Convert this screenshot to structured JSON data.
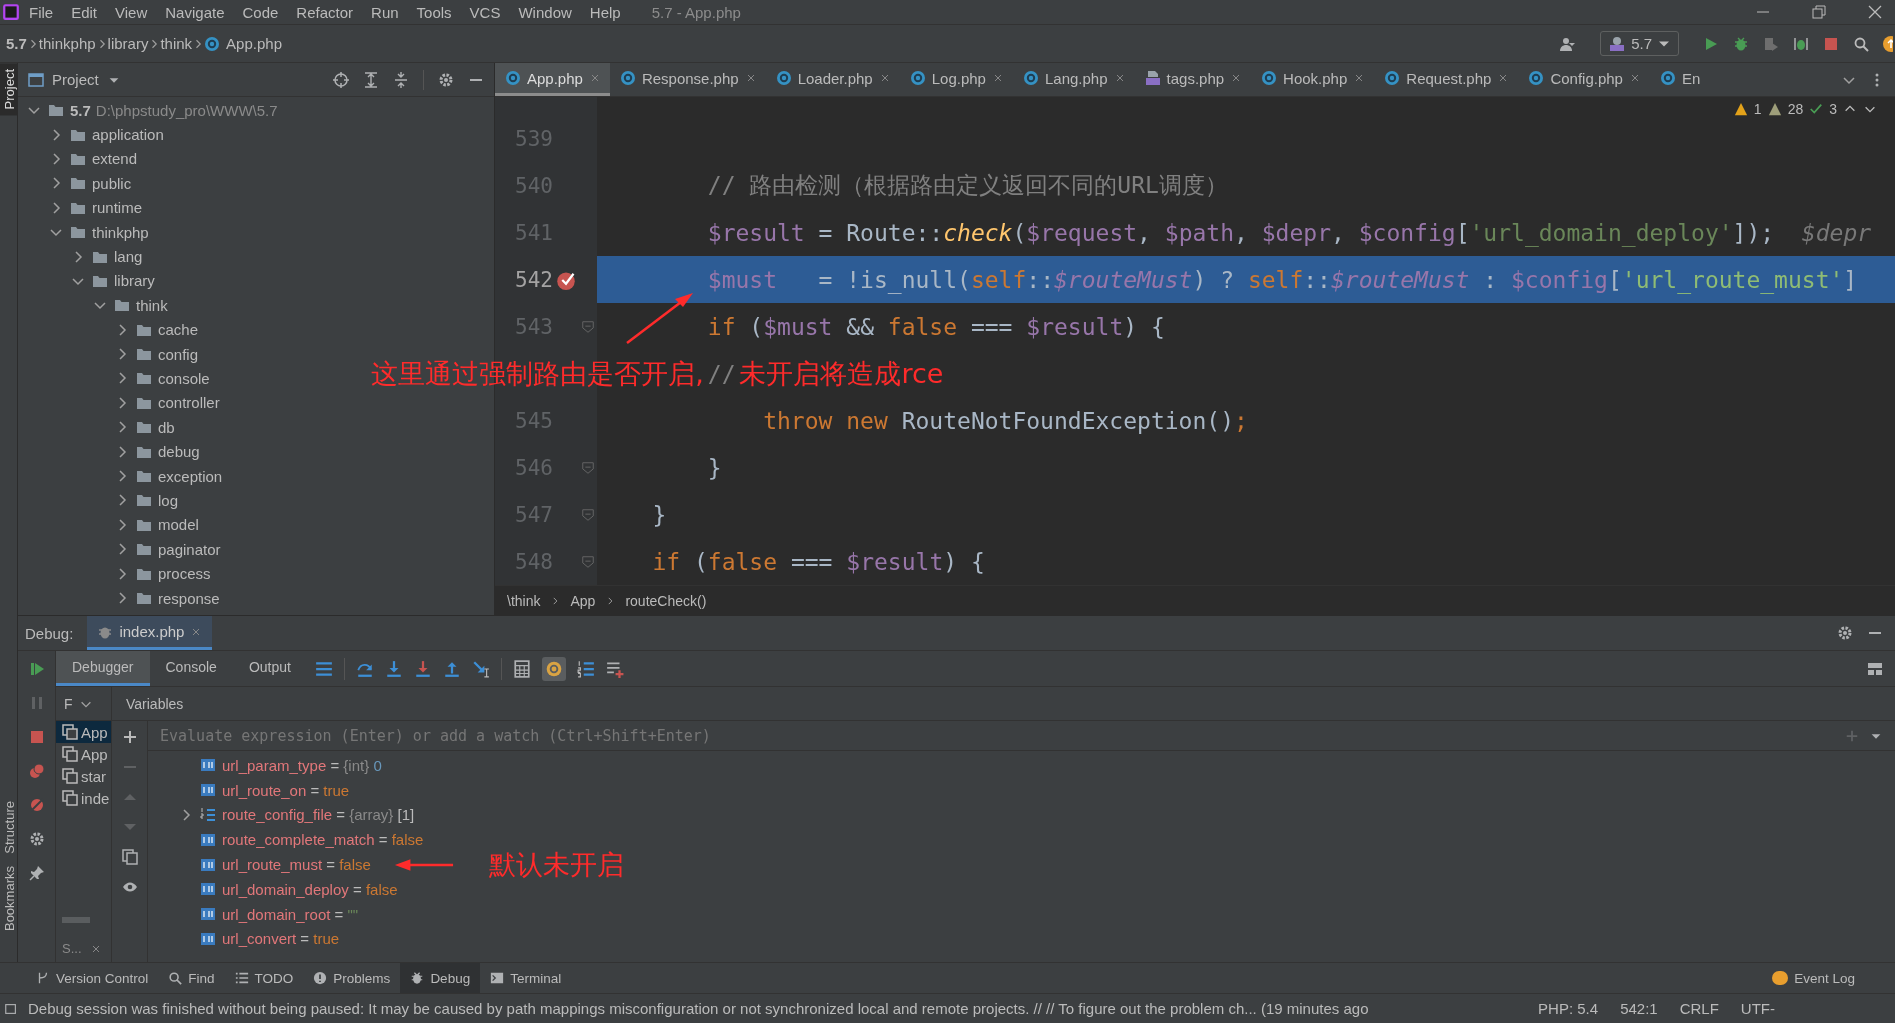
{
  "menu": [
    "File",
    "Edit",
    "View",
    "Navigate",
    "Code",
    "Refactor",
    "Run",
    "Tools",
    "VCS",
    "Window",
    "Help"
  ],
  "window": {
    "title": "5.7 - App.php"
  },
  "nav_path": [
    "5.7",
    "thinkphp",
    "library",
    "think",
    "App.php"
  ],
  "toolbar": {
    "run_config": "5.7"
  },
  "side_strip": {
    "top": [
      {
        "label": "Project",
        "selected": true
      }
    ],
    "bottom": [
      {
        "label": "Structure",
        "selected": false
      },
      {
        "label": "Bookmarks",
        "selected": false
      }
    ]
  },
  "project_panel": {
    "title": "Project",
    "tree": [
      {
        "label": "5.7",
        "path": "D:\\phpstudy_pro\\WWW\\5.7",
        "expanded": true,
        "children": [
          {
            "label": "application",
            "expanded": false
          },
          {
            "label": "extend",
            "expanded": false
          },
          {
            "label": "public",
            "expanded": false
          },
          {
            "label": "runtime",
            "expanded": false
          },
          {
            "label": "thinkphp",
            "expanded": true,
            "children": [
              {
                "label": "lang",
                "expanded": false
              },
              {
                "label": "library",
                "expanded": true,
                "children": [
                  {
                    "label": "think",
                    "expanded": true,
                    "children": [
                      {
                        "label": "cache",
                        "expanded": false
                      },
                      {
                        "label": "config",
                        "expanded": false
                      },
                      {
                        "label": "console",
                        "expanded": false
                      },
                      {
                        "label": "controller",
                        "expanded": false
                      },
                      {
                        "label": "db",
                        "expanded": false
                      },
                      {
                        "label": "debug",
                        "expanded": false
                      },
                      {
                        "label": "exception",
                        "expanded": false
                      },
                      {
                        "label": "log",
                        "expanded": false
                      },
                      {
                        "label": "model",
                        "expanded": false
                      },
                      {
                        "label": "paginator",
                        "expanded": false
                      },
                      {
                        "label": "process",
                        "expanded": false
                      },
                      {
                        "label": "response",
                        "expanded": false
                      }
                    ]
                  }
                ]
              }
            ]
          }
        ]
      }
    ]
  },
  "editor": {
    "tabs": [
      {
        "label": "App.php",
        "selected": true,
        "kind": "class"
      },
      {
        "label": "Response.php",
        "selected": false,
        "kind": "class"
      },
      {
        "label": "Loader.php",
        "selected": false,
        "kind": "class"
      },
      {
        "label": "Log.php",
        "selected": false,
        "kind": "class"
      },
      {
        "label": "Lang.php",
        "selected": false,
        "kind": "class"
      },
      {
        "label": "tags.php",
        "selected": false,
        "kind": "php"
      },
      {
        "label": "Hook.php",
        "selected": false,
        "kind": "class"
      },
      {
        "label": "Request.php",
        "selected": false,
        "kind": "class"
      },
      {
        "label": "Config.php",
        "selected": false,
        "kind": "class"
      },
      {
        "label": "En",
        "selected": false,
        "kind": "class"
      }
    ],
    "inspections": {
      "errors": "1",
      "warnings": "28",
      "typos": "3"
    },
    "lines": [
      {
        "number": "539"
      },
      {
        "number": "540",
        "tokens": [
          {
            "kind": "comment",
            "text": "        // 路由检测（根据路由定义返回不同的URL调度）"
          }
        ]
      },
      {
        "number": "541",
        "tokens": [
          {
            "kind": "var",
            "text": "        $result"
          },
          {
            "kind": "plain",
            "text": " = Route::"
          },
          {
            "kind": "func",
            "text": "check"
          },
          {
            "kind": "plain",
            "text": "("
          },
          {
            "kind": "var",
            "text": "$request"
          },
          {
            "kind": "plain",
            "text": ", "
          },
          {
            "kind": "var",
            "text": "$path"
          },
          {
            "kind": "plain",
            "text": ", "
          },
          {
            "kind": "var",
            "text": "$depr"
          },
          {
            "kind": "plain",
            "text": ", "
          },
          {
            "kind": "var",
            "text": "$config"
          },
          {
            "kind": "plain",
            "text": "["
          },
          {
            "kind": "str",
            "text": "'url_domain_deploy'"
          },
          {
            "kind": "plain",
            "text": "]);"
          },
          {
            "kind": "hint",
            "text": "  $depr"
          }
        ]
      },
      {
        "number": "542",
        "current": true,
        "breakpoint": true,
        "tokens": [
          {
            "kind": "var",
            "text": "        $must"
          },
          {
            "kind": "plain",
            "text": "   = !is_null("
          },
          {
            "kind": "kw",
            "text": "self"
          },
          {
            "kind": "plain",
            "text": "::"
          },
          {
            "kind": "static",
            "text": "$routeMust"
          },
          {
            "kind": "plain",
            "text": ") ? "
          },
          {
            "kind": "kw",
            "text": "self"
          },
          {
            "kind": "plain",
            "text": "::"
          },
          {
            "kind": "static",
            "text": "$routeMust"
          },
          {
            "kind": "plain",
            "text": " : "
          },
          {
            "kind": "var",
            "text": "$config"
          },
          {
            "kind": "plain",
            "text": "["
          },
          {
            "kind": "str",
            "text": "'url_route_must'"
          },
          {
            "kind": "plain",
            "text": "]"
          }
        ]
      },
      {
        "number": "543",
        "fold": true,
        "tokens": [
          {
            "kind": "kw",
            "text": "        if"
          },
          {
            "kind": "plain",
            "text": " ("
          },
          {
            "kind": "var",
            "text": "$must"
          },
          {
            "kind": "plain",
            "text": " && "
          },
          {
            "kind": "kw",
            "text": "false"
          },
          {
            "kind": "plain",
            "text": " === "
          },
          {
            "kind": "var",
            "text": "$result"
          },
          {
            "kind": "plain",
            "text": ") {"
          }
        ]
      },
      {
        "tokens": [
          {
            "kind": "comment",
            "text": "        //"
          }
        ],
        "note_before": "这里通过强制路由是否开启,",
        "note_after": "未开启将造成rce"
      },
      {
        "number": "545",
        "tokens": [
          {
            "kind": "kw",
            "text": "            throw new"
          },
          {
            "kind": "plain",
            "text": " RouteNotFoundException()"
          },
          {
            "kind": "kw",
            "text": ";"
          }
        ]
      },
      {
        "number": "546",
        "fold": true,
        "tokens": [
          {
            "kind": "plain",
            "text": "        }"
          }
        ]
      },
      {
        "number": "547",
        "fold": true,
        "tokens": [
          {
            "kind": "plain",
            "text": "    }"
          }
        ]
      },
      {
        "number": "548",
        "fold": true,
        "tokens": [
          {
            "kind": "kw",
            "text": "    if"
          },
          {
            "kind": "plain",
            "text": " ("
          },
          {
            "kind": "kw",
            "text": "false"
          },
          {
            "kind": "plain",
            "text": " === "
          },
          {
            "kind": "var",
            "text": "$result"
          },
          {
            "kind": "plain",
            "text": ") {"
          }
        ]
      }
    ],
    "breadcrumbs": [
      "\\think",
      "App",
      "routeCheck()"
    ]
  },
  "debug": {
    "label": "Debug:",
    "session": "index.php",
    "tabs": [
      {
        "label": "Debugger",
        "selected": true
      },
      {
        "label": "Console",
        "selected": false
      },
      {
        "label": "Output",
        "selected": false
      }
    ],
    "frames_header": "F",
    "variables_header": "Variables",
    "frames": [
      {
        "label": "App",
        "selected": true
      },
      {
        "label": "App",
        "selected": false
      },
      {
        "label": "star",
        "selected": false
      },
      {
        "label": "inde",
        "selected": false
      }
    ],
    "collapsed_tab": "S...",
    "watch_placeholder": "Evaluate expression (Enter) or add a watch (Ctrl+Shift+Enter)",
    "variables": [
      {
        "name": "url_param_type",
        "separator": "=",
        "type": "{int}",
        "value": "0",
        "color": "#6897bb",
        "kind": "scalar"
      },
      {
        "name": "url_route_on",
        "separator": "=",
        "value": "true",
        "color": "#cc7832",
        "kind": "scalar"
      },
      {
        "name": "route_config_file",
        "separator": "=",
        "type": "{array}",
        "value": "[1]",
        "color": "#bbbbbb",
        "kind": "array",
        "expanded": false
      },
      {
        "name": "route_complete_match",
        "separator": "=",
        "value": "false",
        "color": "#cc7832",
        "kind": "scalar"
      },
      {
        "name": "url_route_must",
        "separator": "=",
        "value": "false",
        "color": "#cc7832",
        "kind": "scalar",
        "note": "默认未开启"
      },
      {
        "name": "url_domain_deploy",
        "separator": "=",
        "value": "false",
        "color": "#cc7832",
        "kind": "scalar"
      },
      {
        "name": "url_domain_root",
        "separator": "=",
        "value": "\"\"",
        "color": "#6a8759",
        "kind": "scalar"
      },
      {
        "name": "url_convert",
        "separator": "=",
        "value": "true",
        "color": "#cc7832",
        "kind": "scalar"
      }
    ]
  },
  "tool_tabs": [
    {
      "label": "Version Control",
      "kind": "vcs",
      "selected": false
    },
    {
      "label": "Find",
      "kind": "find",
      "selected": false
    },
    {
      "label": "TODO",
      "kind": "todo",
      "selected": false
    },
    {
      "label": "Problems",
      "kind": "problems",
      "selected": false
    },
    {
      "label": "Debug",
      "kind": "debug",
      "selected": true
    },
    {
      "label": "Terminal",
      "kind": "terminal",
      "selected": false
    }
  ],
  "event_log": "Event Log",
  "status_bar": {
    "message": "Debug session was finished without being paused: It may be caused by path mappings misconfiguration or not synchronized local and remote projects. // // To figure out the problem ch... (19 minutes ago",
    "items": [
      "PHP: 5.4",
      "542:1",
      "CRLF",
      "UTF-"
    ]
  }
}
